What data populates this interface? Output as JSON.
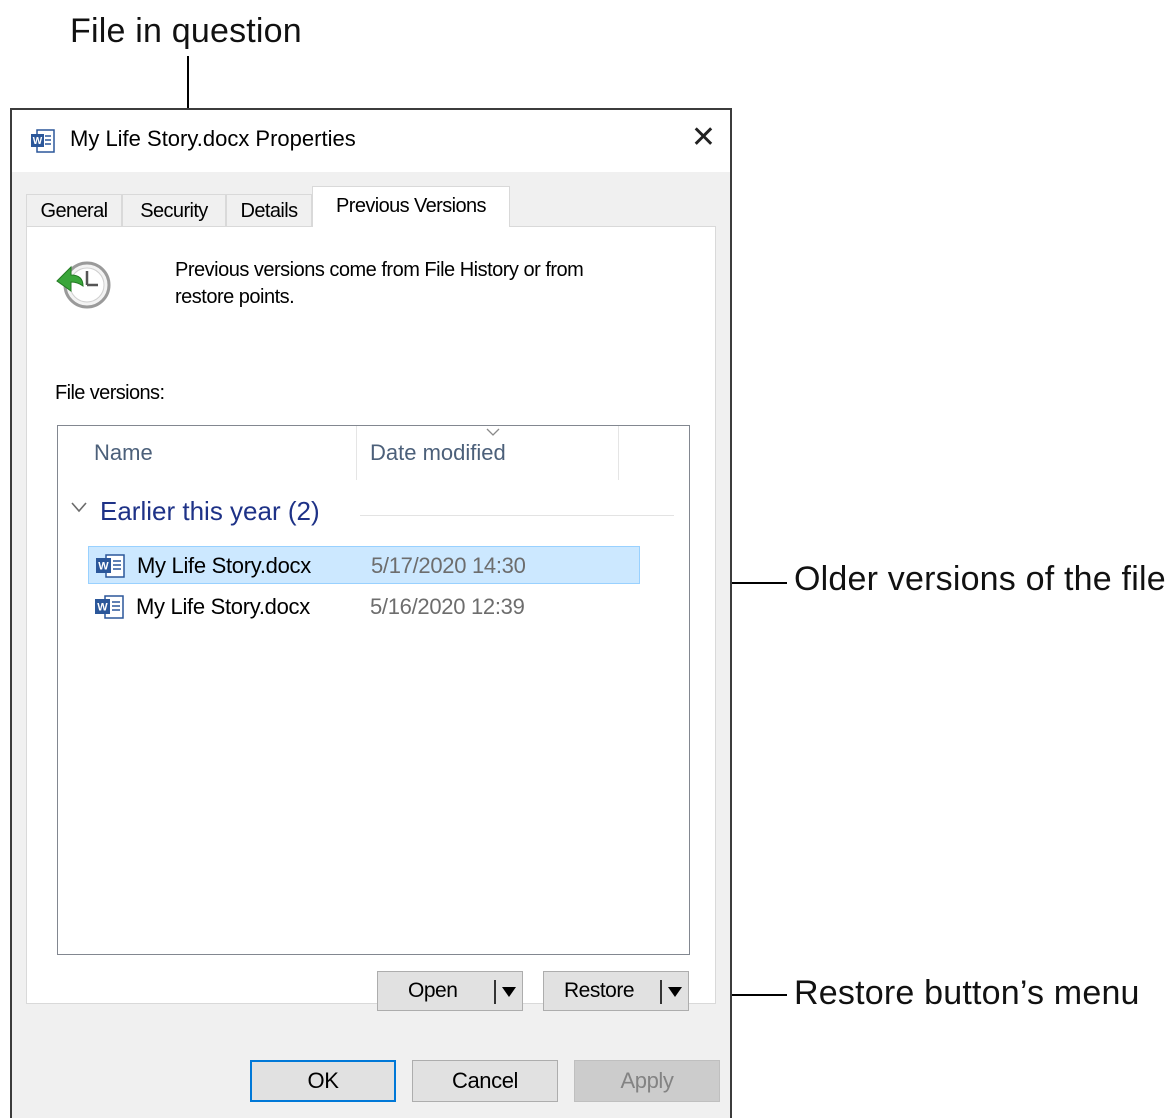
{
  "callouts": {
    "file_in_question": "File in question",
    "older_versions": "Older versions of the file",
    "restore_menu": "Restore button’s menu"
  },
  "dialog": {
    "title": "My Life Story.docx Properties",
    "close_glyph": "✕",
    "tabs": [
      "General",
      "Security",
      "Details",
      "Previous Versions"
    ],
    "active_tab": "Previous Versions",
    "info_text": "Previous versions come from File History or from restore points.",
    "versions_label": "File versions:",
    "columns": {
      "name": "Name",
      "date": "Date modified"
    },
    "group": {
      "title": "Earlier this year (2)"
    },
    "versions": [
      {
        "name": "My Life Story.docx",
        "date": "5/17/2020 14:30",
        "selected": true
      },
      {
        "name": "My Life Story.docx",
        "date": "5/16/2020 12:39",
        "selected": false
      }
    ],
    "open_button": "Open",
    "restore_button": "Restore",
    "ok_button": "OK",
    "cancel_button": "Cancel",
    "apply_button": "Apply"
  },
  "icons": {
    "title": "word-document-icon",
    "history": "file-history-clock-icon",
    "row": "word-document-icon",
    "group_toggle": "chevron-down-icon",
    "sort": "sort-indicator-icon",
    "split_dropdown": "caret-down-icon"
  },
  "colors": {
    "group_header": "#1e3287",
    "column_header": "#4c607a",
    "selection": "#cce8ff",
    "selection_border": "#99d1ff",
    "default_button_border": "#0078d7",
    "word_blue": "#2b579a"
  }
}
